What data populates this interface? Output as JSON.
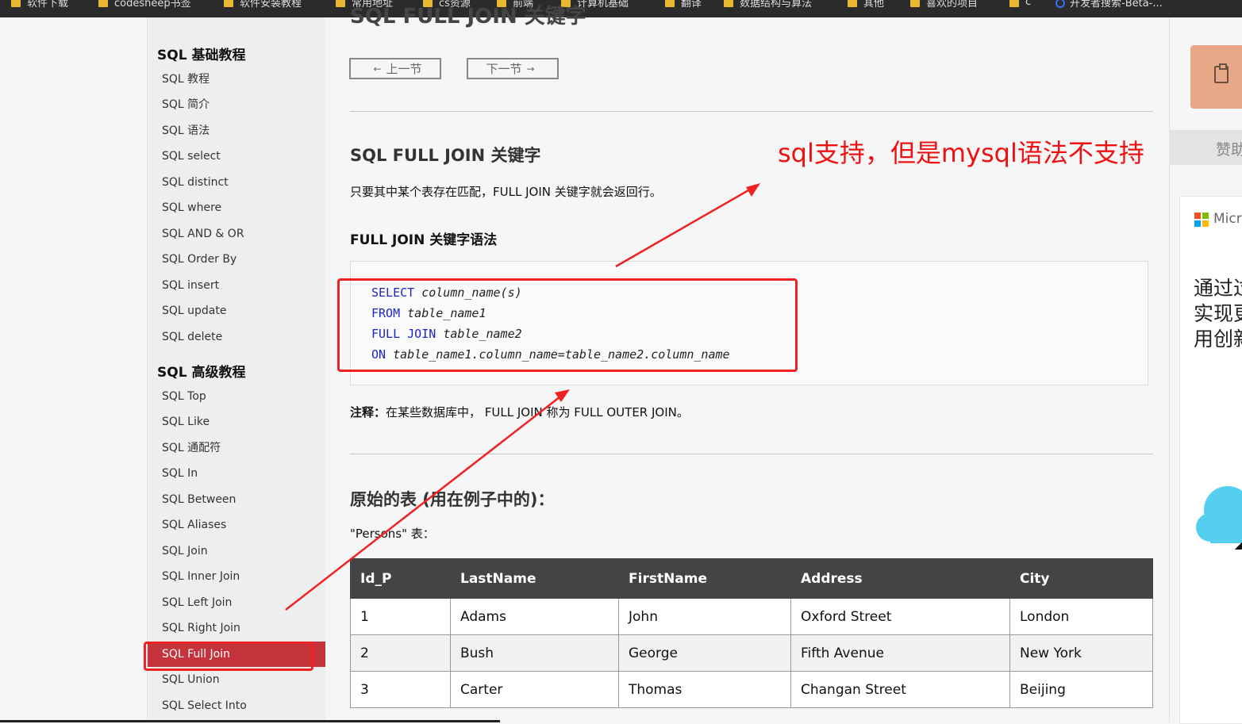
{
  "bookmarks": [
    {
      "label": "软件下载",
      "icon": "folder-icon"
    },
    {
      "label": "codesheep书签",
      "icon": "folder-icon"
    },
    {
      "label": "软件安装教程",
      "icon": "folder-icon"
    },
    {
      "label": "常用地址",
      "icon": "folder-icon"
    },
    {
      "label": "cs资源",
      "icon": "folder-icon"
    },
    {
      "label": "前端",
      "icon": "folder-icon"
    },
    {
      "label": "计算机基础",
      "icon": "folder-icon"
    },
    {
      "label": "翻译",
      "icon": "folder-icon"
    },
    {
      "label": "数据结构与算法",
      "icon": "folder-icon"
    },
    {
      "label": "其他",
      "icon": "folder-icon"
    },
    {
      "label": "喜欢的项目",
      "icon": "folder-icon"
    },
    {
      "label": "c",
      "icon": "folder-icon"
    },
    {
      "label": "开发者搜索-Beta-...",
      "icon": "globe-icon"
    }
  ],
  "sidebar": {
    "basic_heading": "SQL 基础教程",
    "basic_items": [
      "SQL 教程",
      "SQL 简介",
      "SQL 语法",
      "SQL select",
      "SQL distinct",
      "SQL where",
      "SQL AND & OR",
      "SQL Order By",
      "SQL insert",
      "SQL update",
      "SQL delete"
    ],
    "advanced_heading": "SQL 高级教程",
    "advanced_items": [
      "SQL Top",
      "SQL Like",
      "SQL 通配符",
      "SQL In",
      "SQL Between",
      "SQL Aliases",
      "SQL Join",
      "SQL Inner Join",
      "SQL Left Join",
      "SQL Right Join",
      "SQL Full Join",
      "SQL Union",
      "SQL Select Into"
    ],
    "active_item": "SQL Full Join"
  },
  "main": {
    "page_title": "SQL FULL JOIN 关键字",
    "prev_label": "上一节",
    "next_label": "下一节",
    "section_title": "SQL FULL JOIN 关键字",
    "intro": "只要其中某个表存在匹配，FULL JOIN 关键字就会返回行。",
    "syntax_title": "FULL JOIN 关键字语法",
    "code": {
      "line1_kw": "SELECT",
      "line1_rest": "column_name(s)",
      "line2_kw": "FROM",
      "line2_rest": "table_name1",
      "line3_kw": "FULL JOIN",
      "line3_rest": "table_name2",
      "line4_kw": "ON",
      "line4_rest": "table_name1.column_name=table_name2.column_name"
    },
    "note_label": "注释：",
    "note_text": "在某些数据库中， FULL JOIN 称为 FULL OUTER JOIN。",
    "tables_title": "原始的表 (用在例子中的)：",
    "persons_caption": "\"Persons\" 表：",
    "table": {
      "headers": [
        "Id_P",
        "LastName",
        "FirstName",
        "Address",
        "City"
      ],
      "rows": [
        [
          "1",
          "Adams",
          "John",
          "Oxford Street",
          "London"
        ],
        [
          "2",
          "Bush",
          "George",
          "Fifth Avenue",
          "New York"
        ],
        [
          "3",
          "Carter",
          "Thomas",
          "Changan Street",
          "Beijing"
        ]
      ]
    }
  },
  "annotation": {
    "text": "sql支持，但是mysql语法不支持",
    "color": "#ee1111"
  },
  "rail": {
    "band_text": "赞助",
    "ad_brand": "Micro",
    "ad_lines": [
      "通过过",
      "实现更",
      "用创新"
    ]
  },
  "colors": {
    "active_sidebar": "#c5343c",
    "keyword": "#1c26c4",
    "table_header": "#444444"
  }
}
